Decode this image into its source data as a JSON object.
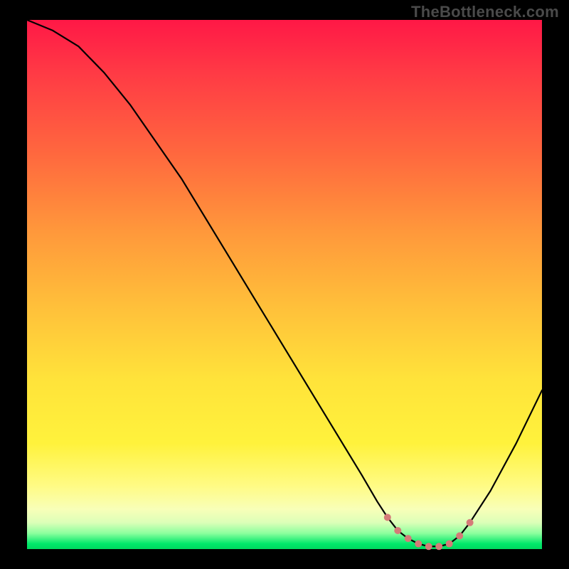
{
  "watermark": "TheBottleneck.com",
  "colors": {
    "background": "#000000",
    "curve_stroke": "#000000",
    "marker_fill": "#d57b78",
    "gradient_top": "#ff1846",
    "gradient_mid": "#ffe33a",
    "gradient_bottom": "#00d85f"
  },
  "chart_data": {
    "type": "line",
    "title": "",
    "xlabel": "",
    "ylabel": "",
    "xlim": [
      0,
      100
    ],
    "ylim": [
      0,
      100
    ],
    "x": [
      0,
      5,
      10,
      15,
      20,
      25,
      30,
      35,
      40,
      45,
      50,
      55,
      60,
      65,
      68,
      70,
      72,
      74,
      76,
      78,
      80,
      82,
      84,
      86,
      90,
      95,
      100
    ],
    "values": [
      100,
      98,
      95,
      90,
      84,
      77,
      70,
      62,
      54,
      46,
      38,
      30,
      22,
      14,
      9,
      6,
      3.5,
      2,
      1,
      0.5,
      0.5,
      1,
      2.5,
      5,
      11,
      20,
      30
    ],
    "highlight_points": {
      "x": [
        70,
        72,
        74,
        76,
        78,
        80,
        82,
        84,
        86
      ],
      "values": [
        6,
        3.5,
        2,
        1,
        0.5,
        0.5,
        1,
        2.5,
        5
      ]
    }
  }
}
